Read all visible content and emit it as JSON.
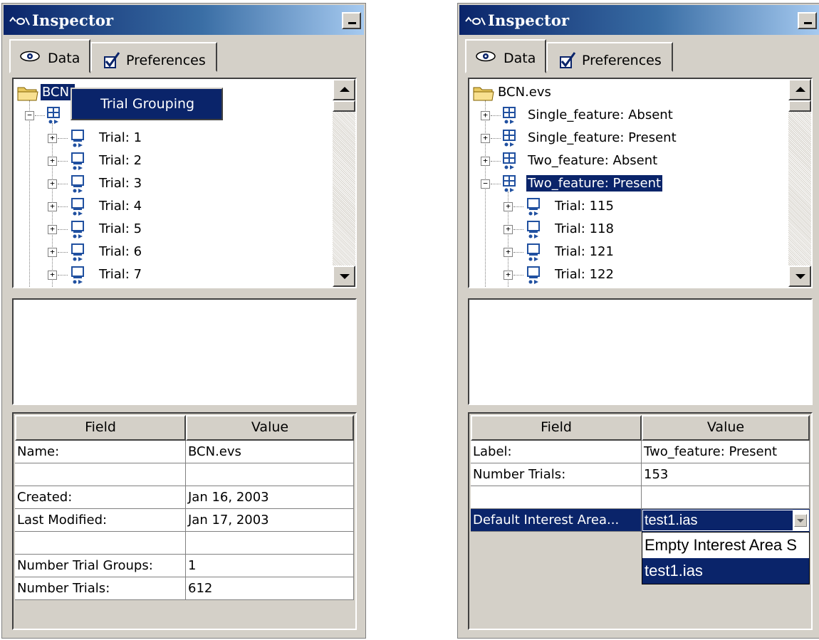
{
  "colors": {
    "selection": "#0a246a",
    "face": "#d4d0c8",
    "title_start": "#0a246a",
    "title_end": "#a6caf0"
  },
  "left": {
    "title": "Inspector",
    "tabs": {
      "data": "Data",
      "preferences": "Preferences"
    },
    "tree": {
      "root": "BCN.",
      "group_icon": "trial-group-icon",
      "trials": [
        "Trial: 1",
        "Trial: 2",
        "Trial: 3",
        "Trial: 4",
        "Trial: 5",
        "Trial: 6",
        "Trial: 7"
      ]
    },
    "context_menu": {
      "item": "Trial Grouping"
    },
    "grid": {
      "headers": {
        "field": "Field",
        "value": "Value"
      },
      "rows": [
        {
          "field": "Name:",
          "value": "BCN.evs"
        },
        {
          "field": "",
          "value": ""
        },
        {
          "field": "Created:",
          "value": "Jan 16, 2003"
        },
        {
          "field": "Last Modified:",
          "value": "Jan 17, 2003"
        },
        {
          "field": "",
          "value": ""
        },
        {
          "field": "Number Trial Groups:",
          "value": "1"
        },
        {
          "field": "Number Trials:",
          "value": "612"
        }
      ]
    }
  },
  "right": {
    "title": "Inspector",
    "tabs": {
      "data": "Data",
      "preferences": "Preferences"
    },
    "tree": {
      "root": "BCN.evs",
      "groups": [
        "Single_feature: Absent",
        "Single_feature: Present",
        "Two_feature: Absent",
        "Two_feature: Present"
      ],
      "trials": [
        "Trial: 115",
        "Trial: 118",
        "Trial: 121",
        "Trial: 122"
      ]
    },
    "grid": {
      "headers": {
        "field": "Field",
        "value": "Value"
      },
      "rows": [
        {
          "field": "Label:",
          "value": "Two_feature: Present"
        },
        {
          "field": "Number Trials:",
          "value": "153"
        },
        {
          "field": "",
          "value": ""
        },
        {
          "field": "Default Interest Area...",
          "value": "test1.ias"
        }
      ],
      "dropdown_options": [
        "Empty Interest Area S",
        "test1.ias"
      ]
    }
  }
}
